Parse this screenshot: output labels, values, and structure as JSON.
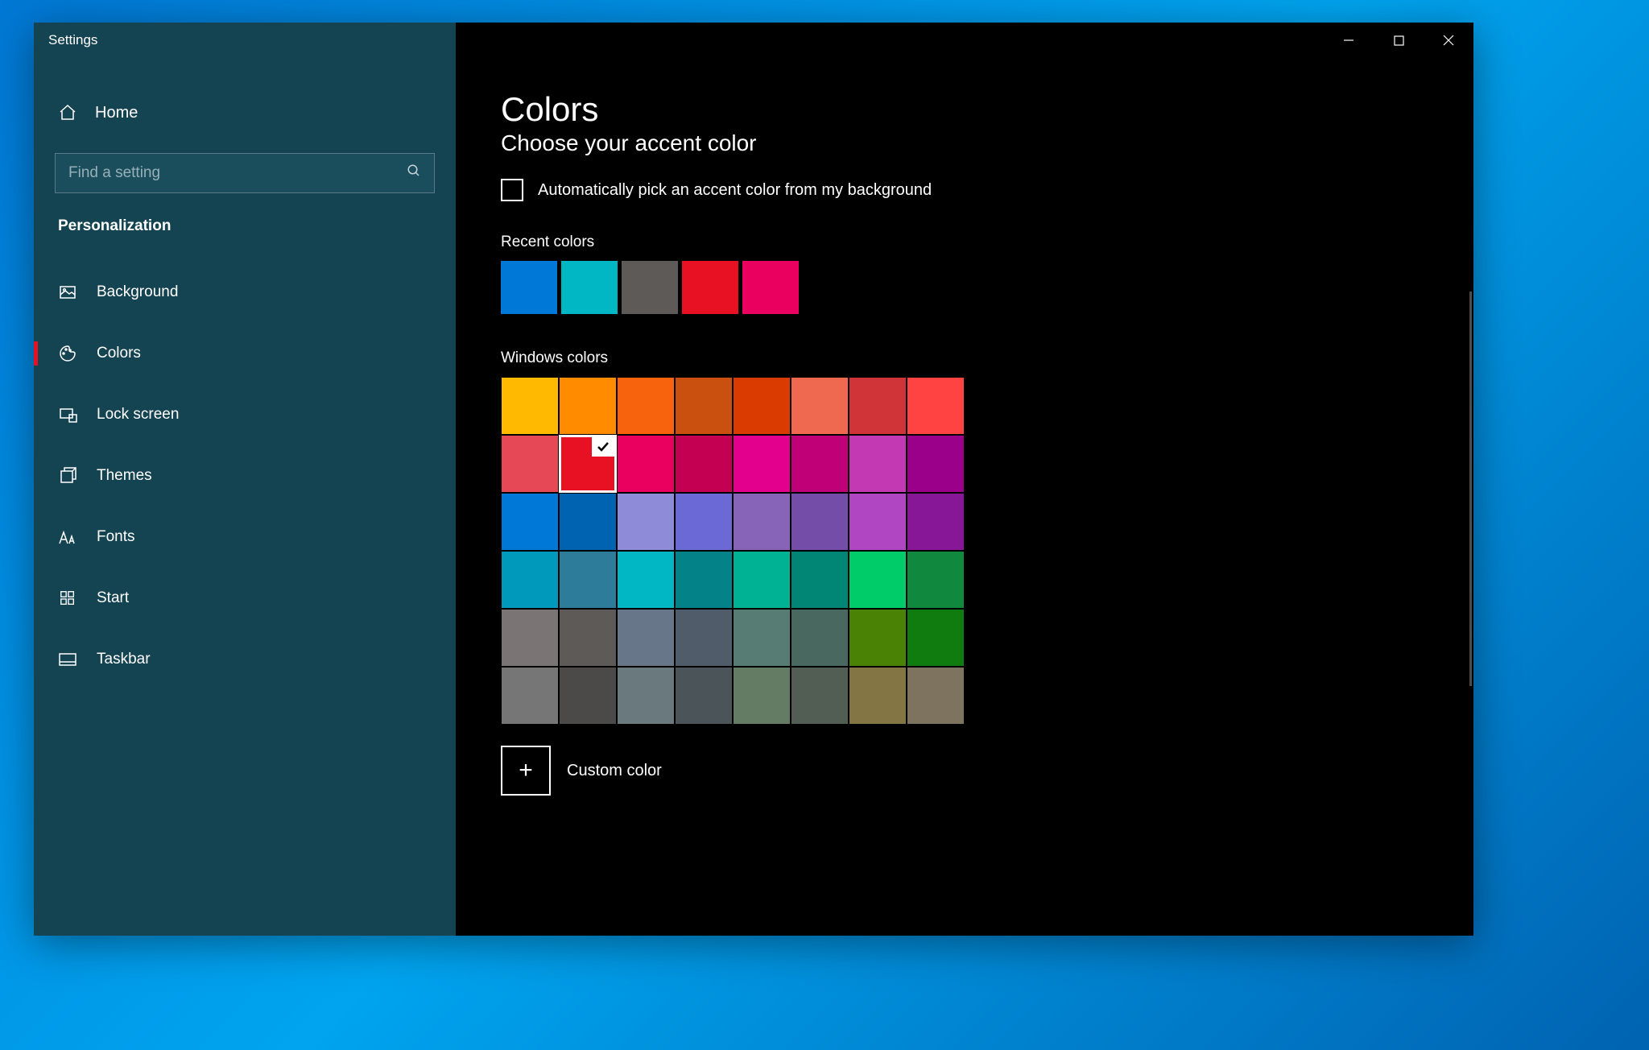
{
  "window": {
    "title": "Settings"
  },
  "sidebar": {
    "home_label": "Home",
    "search_placeholder": "Find a setting",
    "section_label": "Personalization",
    "items": [
      {
        "label": "Background",
        "icon": "image-icon"
      },
      {
        "label": "Colors",
        "icon": "palette-icon",
        "active": true
      },
      {
        "label": "Lock screen",
        "icon": "lockscreen-icon"
      },
      {
        "label": "Themes",
        "icon": "themes-icon"
      },
      {
        "label": "Fonts",
        "icon": "font-icon"
      },
      {
        "label": "Start",
        "icon": "start-icon"
      },
      {
        "label": "Taskbar",
        "icon": "taskbar-icon"
      }
    ]
  },
  "main": {
    "title": "Colors",
    "subtitle": "Choose your accent color",
    "auto_checkbox_label": "Automatically pick an accent color from my background",
    "auto_checkbox_checked": false,
    "recent_label": "Recent colors",
    "recent_colors": [
      "#0078d7",
      "#00b7c3",
      "#5d5a58",
      "#e81123",
      "#ea005e"
    ],
    "windows_label": "Windows colors",
    "windows_colors": [
      "#ffb900",
      "#ff8c00",
      "#f7630c",
      "#ca5010",
      "#da3b01",
      "#ef6950",
      "#d13438",
      "#ff4343",
      "#e74856",
      "#e81123",
      "#ea005e",
      "#c30052",
      "#e3008c",
      "#bf0077",
      "#c239b3",
      "#9a0089",
      "#0078d7",
      "#0063b1",
      "#8e8cd8",
      "#6b69d6",
      "#8764b8",
      "#744da9",
      "#b146c2",
      "#881798",
      "#0099bc",
      "#2d7d9a",
      "#00b7c3",
      "#038387",
      "#00b294",
      "#018574",
      "#00cc6a",
      "#10893e",
      "#7a7574",
      "#5d5a58",
      "#68768a",
      "#515c6b",
      "#567c73",
      "#486860",
      "#498205",
      "#107c10",
      "#767676",
      "#4c4a48",
      "#69797e",
      "#4a5459",
      "#647c64",
      "#525e54",
      "#847545",
      "#7e735f"
    ],
    "selected_index": 9,
    "custom_label": "Custom color"
  }
}
